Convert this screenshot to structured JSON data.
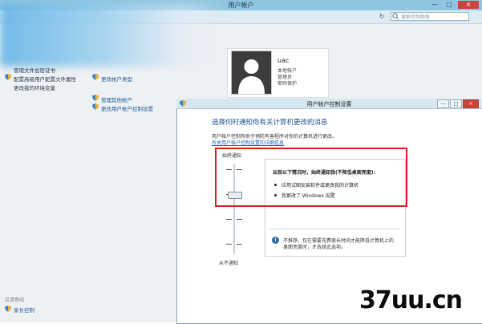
{
  "back_window": {
    "title": "用户帐户",
    "controls": {
      "minimize": "—",
      "maximize": "□",
      "close": "×"
    },
    "search_placeholder": "搜索控制面板",
    "refresh": "↻"
  },
  "left_pane": {
    "links": [
      "管理文件加密证书",
      "配置高级用户配置文件属性",
      "更改我的环境变量"
    ],
    "see_also": "另请参阅",
    "family_safety": "家长控制"
  },
  "middle_links": {
    "change_account_type": "更改帐户类型",
    "manage_other_account": "管理其他帐户",
    "uac_settings": "更改用户帐户控制设置"
  },
  "user_card": {
    "name": "uac",
    "account_type": "本地帐户",
    "role": "管理员",
    "password_status": "密码保护"
  },
  "uac_dialog": {
    "title": "用户帐户控制设置",
    "controls": {
      "minimize": "—",
      "maximize": "□",
      "close": "×"
    },
    "heading": "选择何时通知你有关计算机更改的消息",
    "description": "用户帐户控制有助于预防有害程序对你的计算机进行更改。",
    "link": "有关用户帐户控制设置的详细信息",
    "always_notify": "始终通知",
    "never_notify": "从不通知",
    "slider_level": 3,
    "slider_levels": 4,
    "info_heading": "出现以下情况时，始终通知我(不降低桌面亮度):",
    "bullets": [
      "应用试图安装软件或更改我的计算机",
      "我更改了 Windows 设置"
    ],
    "recommendation_line1": "不推荐。仅在需要花费很长时间才能降低计算机上的",
    "recommendation_line2": "桌面亮度时，才选择此选项。"
  },
  "watermark": "37uu.cn",
  "colors": {
    "highlight": "#d81e25",
    "link": "#1a62b8",
    "heading": "#1b4f8c"
  }
}
